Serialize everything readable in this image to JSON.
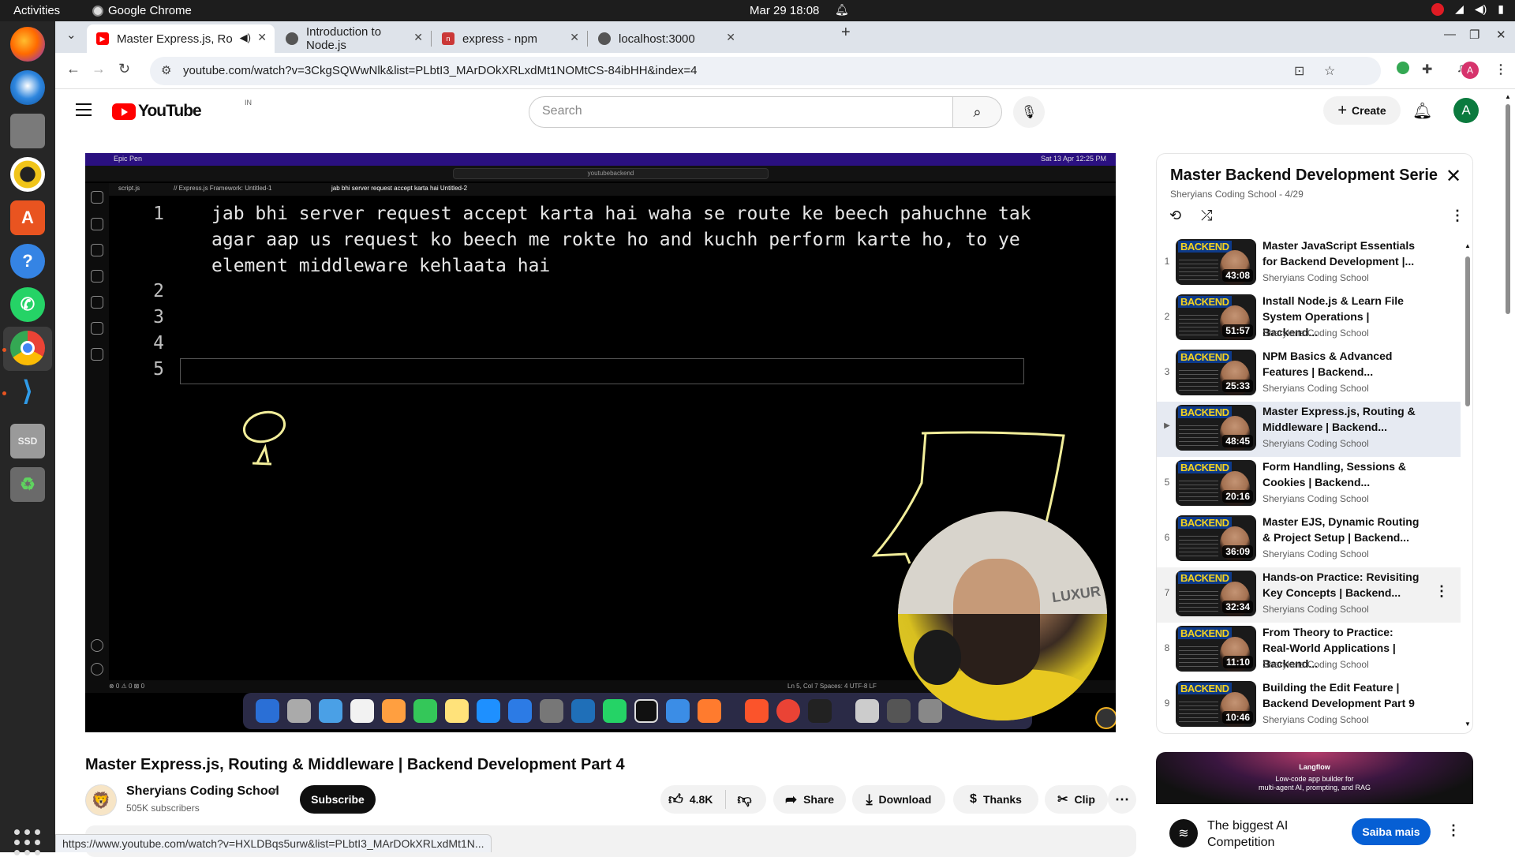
{
  "system": {
    "activities": "Activities",
    "app_name": "Google Chrome",
    "clock": "Mar 29  18:08"
  },
  "tabs": [
    {
      "label": "Master Express.js, Ro",
      "favicon": "youtube-icon",
      "active": true,
      "audio": true
    },
    {
      "label": "Introduction to Node.js",
      "favicon": "globe-icon",
      "active": false
    },
    {
      "label": "express - npm",
      "favicon": "npm-icon",
      "active": false
    },
    {
      "label": "localhost:3000",
      "favicon": "globe-icon",
      "active": false
    }
  ],
  "omnibox": {
    "url": "youtube.com/watch?v=3CkgSQWwNlk&list=PLbtI3_MArDOkXRLxdMt1NOMtCS-84ibHH&index=4"
  },
  "yt_header": {
    "logo_text": "YouTube",
    "country": "IN",
    "search_placeholder": "Search",
    "create_label": "Create",
    "avatar_letter": "A"
  },
  "player": {
    "mac_menubar_left": "Epic Pen",
    "mac_menubar_right": "Sat 13 Apr  12:25 PM",
    "editor_search": "youtubebackend",
    "editor_tabs": [
      "script.js",
      "// Express.js Framework:  Untitled-1",
      "jab bhi server request accept karta hai  Untitled-2"
    ],
    "line_numbers": [
      "1",
      "2",
      "3",
      "4",
      "5"
    ],
    "code_lines": [
      "jab bhi server request accept karta hai waha se route ke beech pahuchne tak",
      "agar aap us request ko beech me rokte ho and kuchh perform karte ho, to ye",
      "element middleware kehlaata hai"
    ],
    "status_left": "⊗ 0 ⚠ 0   ⊠ 0",
    "status_right": "Ln 5, Col 7    Spaces: 4    UTF-8    LF",
    "presenter_sign": "LUXUR"
  },
  "video": {
    "title": "Master Express.js, Routing & Middleware | Backend Development Part 4",
    "channel_name": "Sheryians Coding School",
    "subscribers": "505K subscribers",
    "subscribe_label": "Subscribe",
    "likes": "4.8K",
    "share_label": "Share",
    "download_label": "Download",
    "thanks_label": "Thanks",
    "clip_label": "Clip"
  },
  "status_bar_url": "https://www.youtube.com/watch?v=HXLDBqs5urw&list=PLbtI3_MArDOkXRLxdMt1N...",
  "playlist": {
    "title": "Master Backend Development Series...",
    "meta": "Sheryians Coding School - 4/29",
    "items": [
      {
        "index": "1",
        "title": "Master JavaScript Essentials for Backend Development |...",
        "channel": "Sheryians Coding School",
        "duration": "43:08",
        "badge": "BACKEND"
      },
      {
        "index": "2",
        "title": "Install Node.js & Learn File System Operations | Backend...",
        "channel": "Sheryians Coding School",
        "duration": "51:57",
        "badge": "BACKEND"
      },
      {
        "index": "3",
        "title": "NPM Basics & Advanced Features | Backend...",
        "channel": "Sheryians Coding School",
        "duration": "25:33",
        "badge": "BACKEND"
      },
      {
        "index": "▶",
        "title": "Master Express.js, Routing & Middleware | Backend...",
        "channel": "Sheryians Coding School",
        "duration": "48:45",
        "badge": "BACKEND"
      },
      {
        "index": "5",
        "title": "Form Handling, Sessions & Cookies | Backend...",
        "channel": "Sheryians Coding School",
        "duration": "20:16",
        "badge": "BACKEND"
      },
      {
        "index": "6",
        "title": "Master EJS, Dynamic Routing & Project Setup | Backend...",
        "channel": "Sheryians Coding School",
        "duration": "36:09",
        "badge": "BACKEND"
      },
      {
        "index": "7",
        "title": "Hands-on Practice: Revisiting Key Concepts | Backend...",
        "channel": "Sheryians Coding School",
        "duration": "32:34",
        "badge": "BACKEND"
      },
      {
        "index": "8",
        "title": "From Theory to Practice: Real-World Applications | Backend...",
        "channel": "Sheryians Coding School",
        "duration": "11:10",
        "badge": "BACKEND"
      },
      {
        "index": "9",
        "title": "Building the Edit Feature | Backend Development Part 9",
        "channel": "Sheryians Coding School",
        "duration": "10:46",
        "badge": "BACKEND"
      }
    ]
  },
  "ad": {
    "banner_logo": "Langflow",
    "banner_line1": "Low-code app builder for",
    "banner_line2": "multi-agent AI, prompting, and RAG",
    "title": "The biggest AI Competition",
    "cta": "Saiba mais"
  },
  "colors": {
    "youtube_red": "#ff0000",
    "current_row": "#e6eaf2",
    "cta_blue": "#065fd4",
    "ubuntu_accent": "#e95420"
  }
}
